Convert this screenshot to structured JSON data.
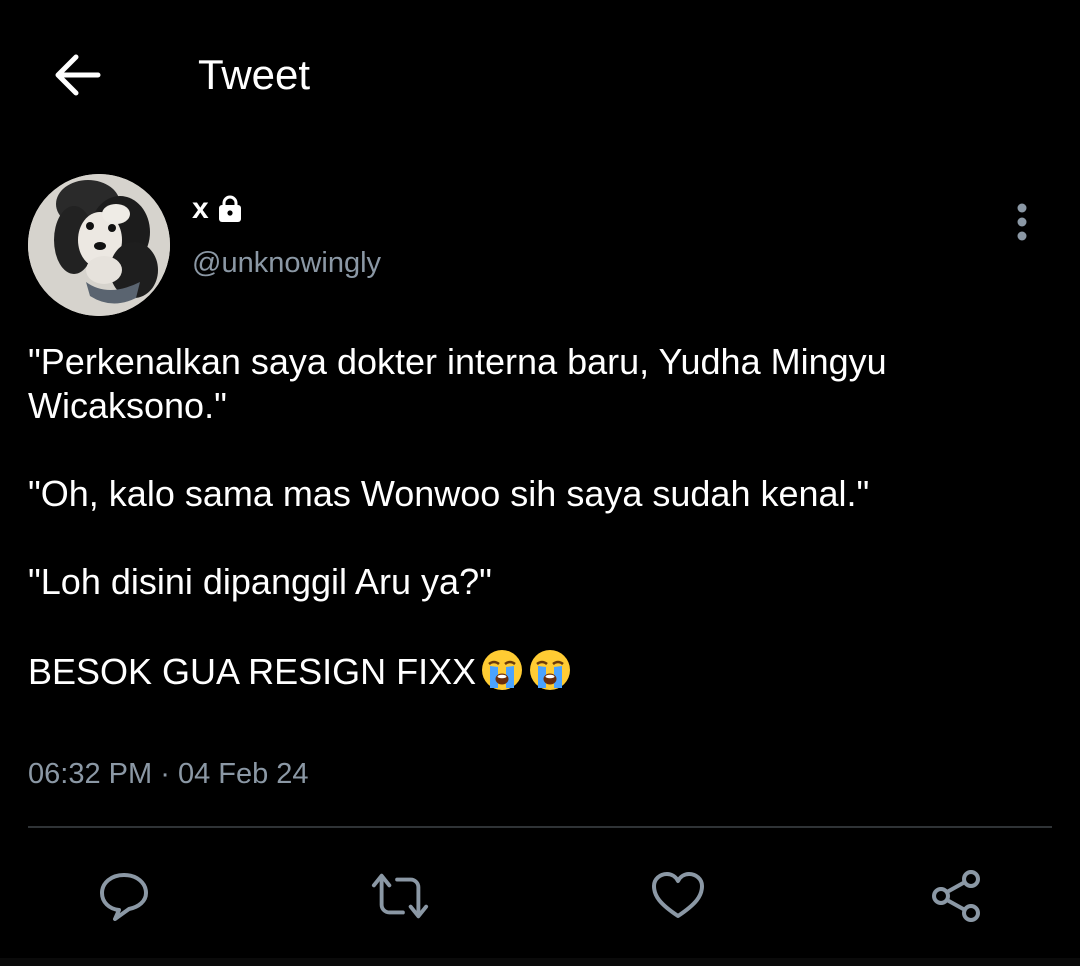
{
  "header": {
    "title": "Tweet",
    "back_icon": "arrow-left-icon"
  },
  "author": {
    "display_name": "x",
    "handle": "@unknowingly",
    "protected_icon": "lock-icon",
    "more_icon": "more-vertical-icon"
  },
  "tweet": {
    "paragraphs": [
      "\"Perkenalkan saya dokter interna baru, Yudha Mingyu Wicaksono.\"",
      "\"Oh, kalo sama mas Wonwoo sih saya sudah kenal.\"",
      "\"Loh disini dipanggil Aru ya?\"",
      "BESOK GUA RESIGN FIXX"
    ],
    "emojis": [
      "😭",
      "😭"
    ],
    "time": "06:32 PM",
    "separator": "·",
    "date": "04 Feb 24"
  },
  "actions": {
    "reply_icon": "reply-icon",
    "retweet_icon": "retweet-icon",
    "like_icon": "heart-icon",
    "share_icon": "share-icon"
  },
  "colors": {
    "background": "#000000",
    "text": "#ffffff",
    "secondary": "#8b98a5",
    "divider": "#2f3336",
    "icon": "#8b98a5"
  }
}
